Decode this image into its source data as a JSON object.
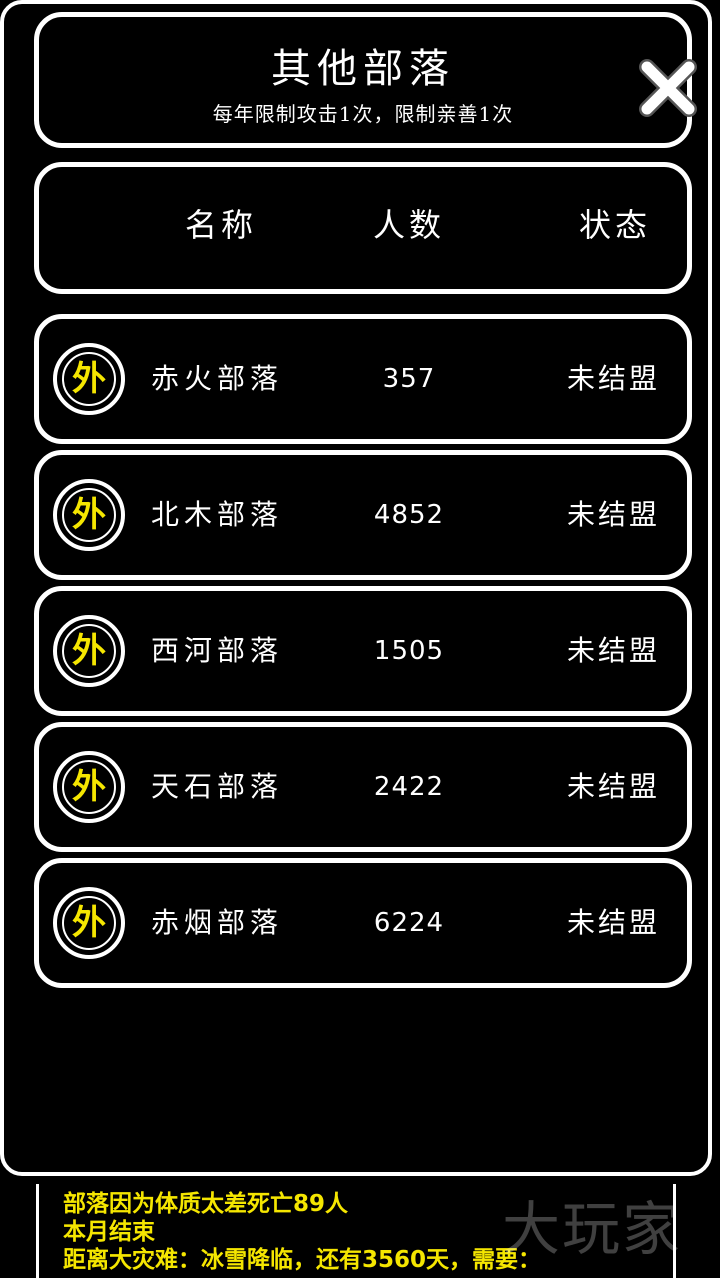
{
  "dialog": {
    "title": "其他部落",
    "subtitle": "每年限制攻击1次，限制亲善1次",
    "close_icon": "close-x-icon"
  },
  "table": {
    "headers": {
      "name": "名称",
      "count": "人数",
      "status": "状态"
    },
    "rows": [
      {
        "badge": "外",
        "name": "赤火部落",
        "count": "357",
        "status": "未结盟"
      },
      {
        "badge": "外",
        "name": "北木部落",
        "count": "4852",
        "status": "未结盟"
      },
      {
        "badge": "外",
        "name": "西河部落",
        "count": "1505",
        "status": "未结盟"
      },
      {
        "badge": "外",
        "name": "天石部落",
        "count": "2422",
        "status": "未结盟"
      },
      {
        "badge": "外",
        "name": "赤烟部落",
        "count": "6224",
        "status": "未结盟"
      }
    ]
  },
  "footer": {
    "lines": [
      "部落因为体质太差死亡89人",
      "本月结束",
      "距离大灾难：冰雪降临，还有3560天，需要："
    ],
    "watermark": "大玩家"
  },
  "colors": {
    "background": "#000000",
    "border": "#ffffff",
    "accent_yellow": "#f5e600"
  }
}
